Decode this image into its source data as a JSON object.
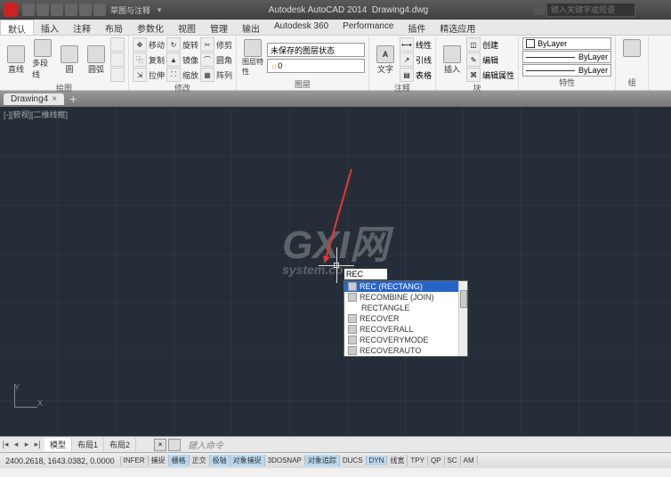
{
  "title": {
    "app": "Autodesk AutoCAD 2014",
    "file": "Drawing4.dwg",
    "search_placeholder": "键入关键字或短语"
  },
  "tabs": {
    "t0": "默认",
    "t1": "插入",
    "t2": "注释",
    "t3": "布局",
    "t4": "参数化",
    "t5": "视图",
    "t6": "管理",
    "t7": "输出",
    "t8": "Autodesk 360",
    "t9": "Performance",
    "t10": "插件",
    "t11": "精选应用",
    "qat_label": "草图与注释"
  },
  "ribbon": {
    "draw": {
      "title": "绘图",
      "line": "直线",
      "polyline": "多段线",
      "circle": "圆",
      "arc": "圆弧"
    },
    "modify": {
      "title": "修改",
      "move": "移动",
      "rotate": "旋转",
      "trim": "修剪",
      "copy": "复制",
      "mirror": "镜像",
      "fillet": "圆角",
      "stretch": "拉伸",
      "scale": "缩放",
      "array": "阵列"
    },
    "layers": {
      "title": "图层",
      "layer_props": "图层特性",
      "state": "未保存的图层状态"
    },
    "annot": {
      "title": "注释",
      "text": "文字",
      "lin": "线性",
      "lead": "引线",
      "table": "表格"
    },
    "block": {
      "title": "块",
      "insert": "插入",
      "create": "创建",
      "edit": "编辑",
      "attr": "编辑属性"
    },
    "props": {
      "title": "特性",
      "bylayer": "ByLayer"
    },
    "groups": {
      "title": "组"
    }
  },
  "doc_tab": "Drawing4",
  "view_label": "[-][俯视][二维线框]",
  "watermark": {
    "main": "GXI网",
    "sub": "system.com"
  },
  "command_input": "REC",
  "autocomplete": [
    {
      "label": "REC (RECTANG)",
      "sel": true
    },
    {
      "label": "RECOMBINE (JOIN)"
    },
    {
      "label": "RECTANGLE"
    },
    {
      "label": "RECOVER"
    },
    {
      "label": "RECOVERALL"
    },
    {
      "label": "RECOVERYMODE"
    },
    {
      "label": "RECOVERAUTO"
    }
  ],
  "ucs": {
    "x": "X",
    "y": "Y"
  },
  "layout_tabs": {
    "model": "模型",
    "l1": "布局1",
    "l2": "布局2"
  },
  "cmd_prompt": "键入命令",
  "status": {
    "coords": "2400.2618, 1643.0382, 0.0000",
    "btns": [
      "INFER",
      "捕捉",
      "栅格",
      "正交",
      "极轴",
      "对象捕捉",
      "3DOSNAP",
      "对象追踪",
      "DUCS",
      "DYN",
      "线宽",
      "TPY",
      "QP",
      "SC",
      "AM"
    ]
  }
}
